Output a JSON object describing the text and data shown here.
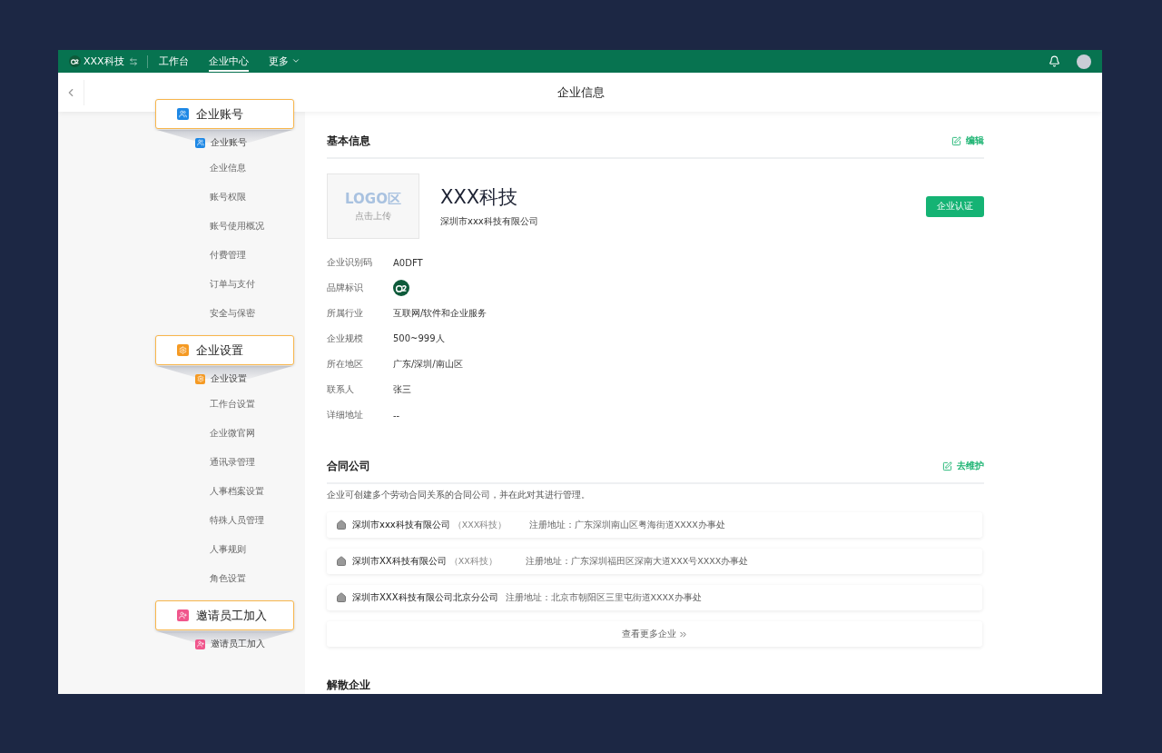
{
  "topbar": {
    "company": "XXX科技",
    "nav": [
      {
        "label": "工作台",
        "selected": false,
        "dropdown": false
      },
      {
        "label": "企业中心",
        "selected": true,
        "dropdown": false
      },
      {
        "label": "更多",
        "selected": false,
        "dropdown": true
      }
    ]
  },
  "header": {
    "title": "企业信息"
  },
  "sidebar": {
    "groups": [
      {
        "callout": "企业账号",
        "heading": "企业账号",
        "kind": "account",
        "color": "#1e88e5",
        "items": [
          "企业信息",
          "账号权限",
          "账号使用概况",
          "付费管理",
          "订单与支付",
          "安全与保密"
        ]
      },
      {
        "callout": "企业设置",
        "heading": "企业设置",
        "kind": "settings",
        "color": "#f59a23",
        "items": [
          "工作台设置",
          "企业微官网",
          "通讯录管理",
          "人事档案设置",
          "特殊人员管理",
          "人事规则",
          "角色设置"
        ]
      },
      {
        "callout": "邀请员工加入",
        "heading": "邀请员工加入",
        "kind": "invite",
        "color": "#f0568c"
      }
    ]
  },
  "basic": {
    "title": "基本信息",
    "action": "编辑",
    "logo": {
      "title": "LOGO区",
      "hint": "点击上传"
    },
    "name": "XXX科技",
    "full_name": "深圳市xxx科技有限公司",
    "certify": "企业认证",
    "fields": [
      {
        "label": "企业识别码",
        "value": "A0DFT",
        "kind": "text"
      },
      {
        "label": "品牌标识",
        "kind": "logo"
      },
      {
        "label": "所属行业",
        "value": "互联网/软件和企业服务",
        "kind": "text"
      },
      {
        "label": "企业规模",
        "value": "500~999人",
        "kind": "text"
      },
      {
        "label": "所在地区",
        "value": "广东/深圳/南山区",
        "kind": "text"
      },
      {
        "label": "联系人",
        "value": "张三",
        "kind": "text"
      },
      {
        "label": "详细地址",
        "value": "--",
        "kind": "text"
      }
    ]
  },
  "contract": {
    "title": "合同公司",
    "action": "去维护",
    "description": "企业可创建多个劳动合同关系的合同公司，并在此对其进行管理。",
    "companies": [
      {
        "name": "深圳市xxx科技有限公司",
        "short": "（XXX科技）",
        "address": "注册地址：广东深圳南山区粤海街道XXXX办事处"
      },
      {
        "name": "深圳市XX科技有限公司",
        "short": "（XX科技）",
        "address": "注册地址：广东深圳福田区深南大道XXX号XXXX办事处"
      },
      {
        "name": "深圳市XXX科技有限公司北京分公司",
        "address": "注册地址：北京市朝阳区三里屯街道XXXX办事处"
      }
    ],
    "more": "查看更多企业"
  },
  "dissolve": {
    "title": "解散企业"
  }
}
